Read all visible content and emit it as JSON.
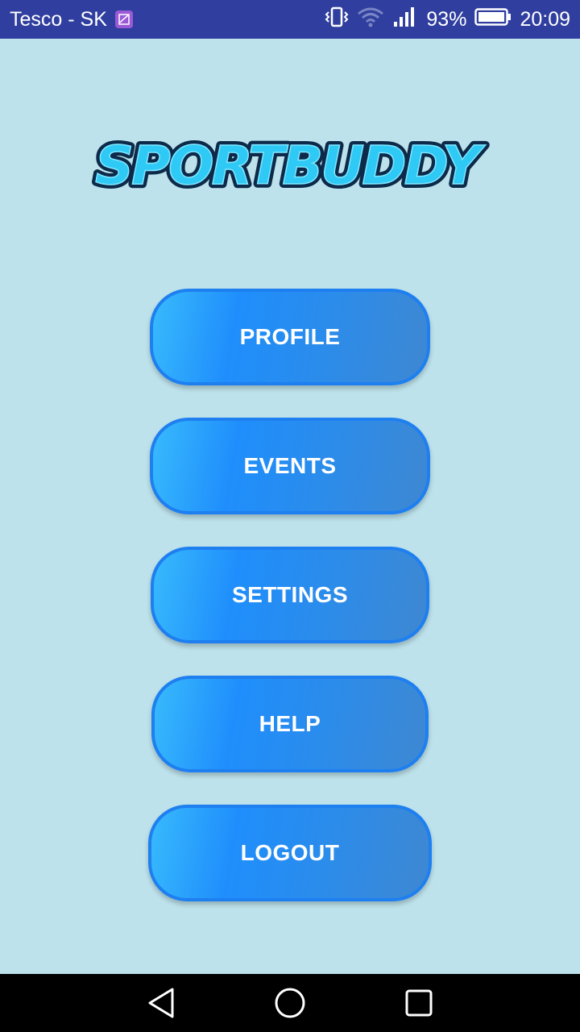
{
  "status_bar": {
    "carrier": "Tesco - SK",
    "battery_percent": "93%",
    "time": "20:09",
    "icons": [
      "gallery-notification-icon",
      "vibrate-icon",
      "wifi-icon",
      "signal-icon",
      "battery-icon"
    ]
  },
  "app": {
    "logo_text": "SPORTBUDDY"
  },
  "menu": {
    "profile": "PROFILE",
    "events": "EVENTS",
    "settings": "SETTINGS",
    "help": "HELP",
    "logout": "LOGOUT"
  },
  "nav": {
    "icons": [
      "back-icon",
      "home-icon",
      "recents-icon"
    ]
  },
  "colors": {
    "background": "#bde2eb",
    "status_bar": "#303f9f",
    "button_border": "#1e7ff0",
    "button_light": "#38bafc",
    "button_dark": "#3e88d2",
    "logo_fill": "#2ec9f5",
    "logo_outline": "#0d2a4a"
  }
}
